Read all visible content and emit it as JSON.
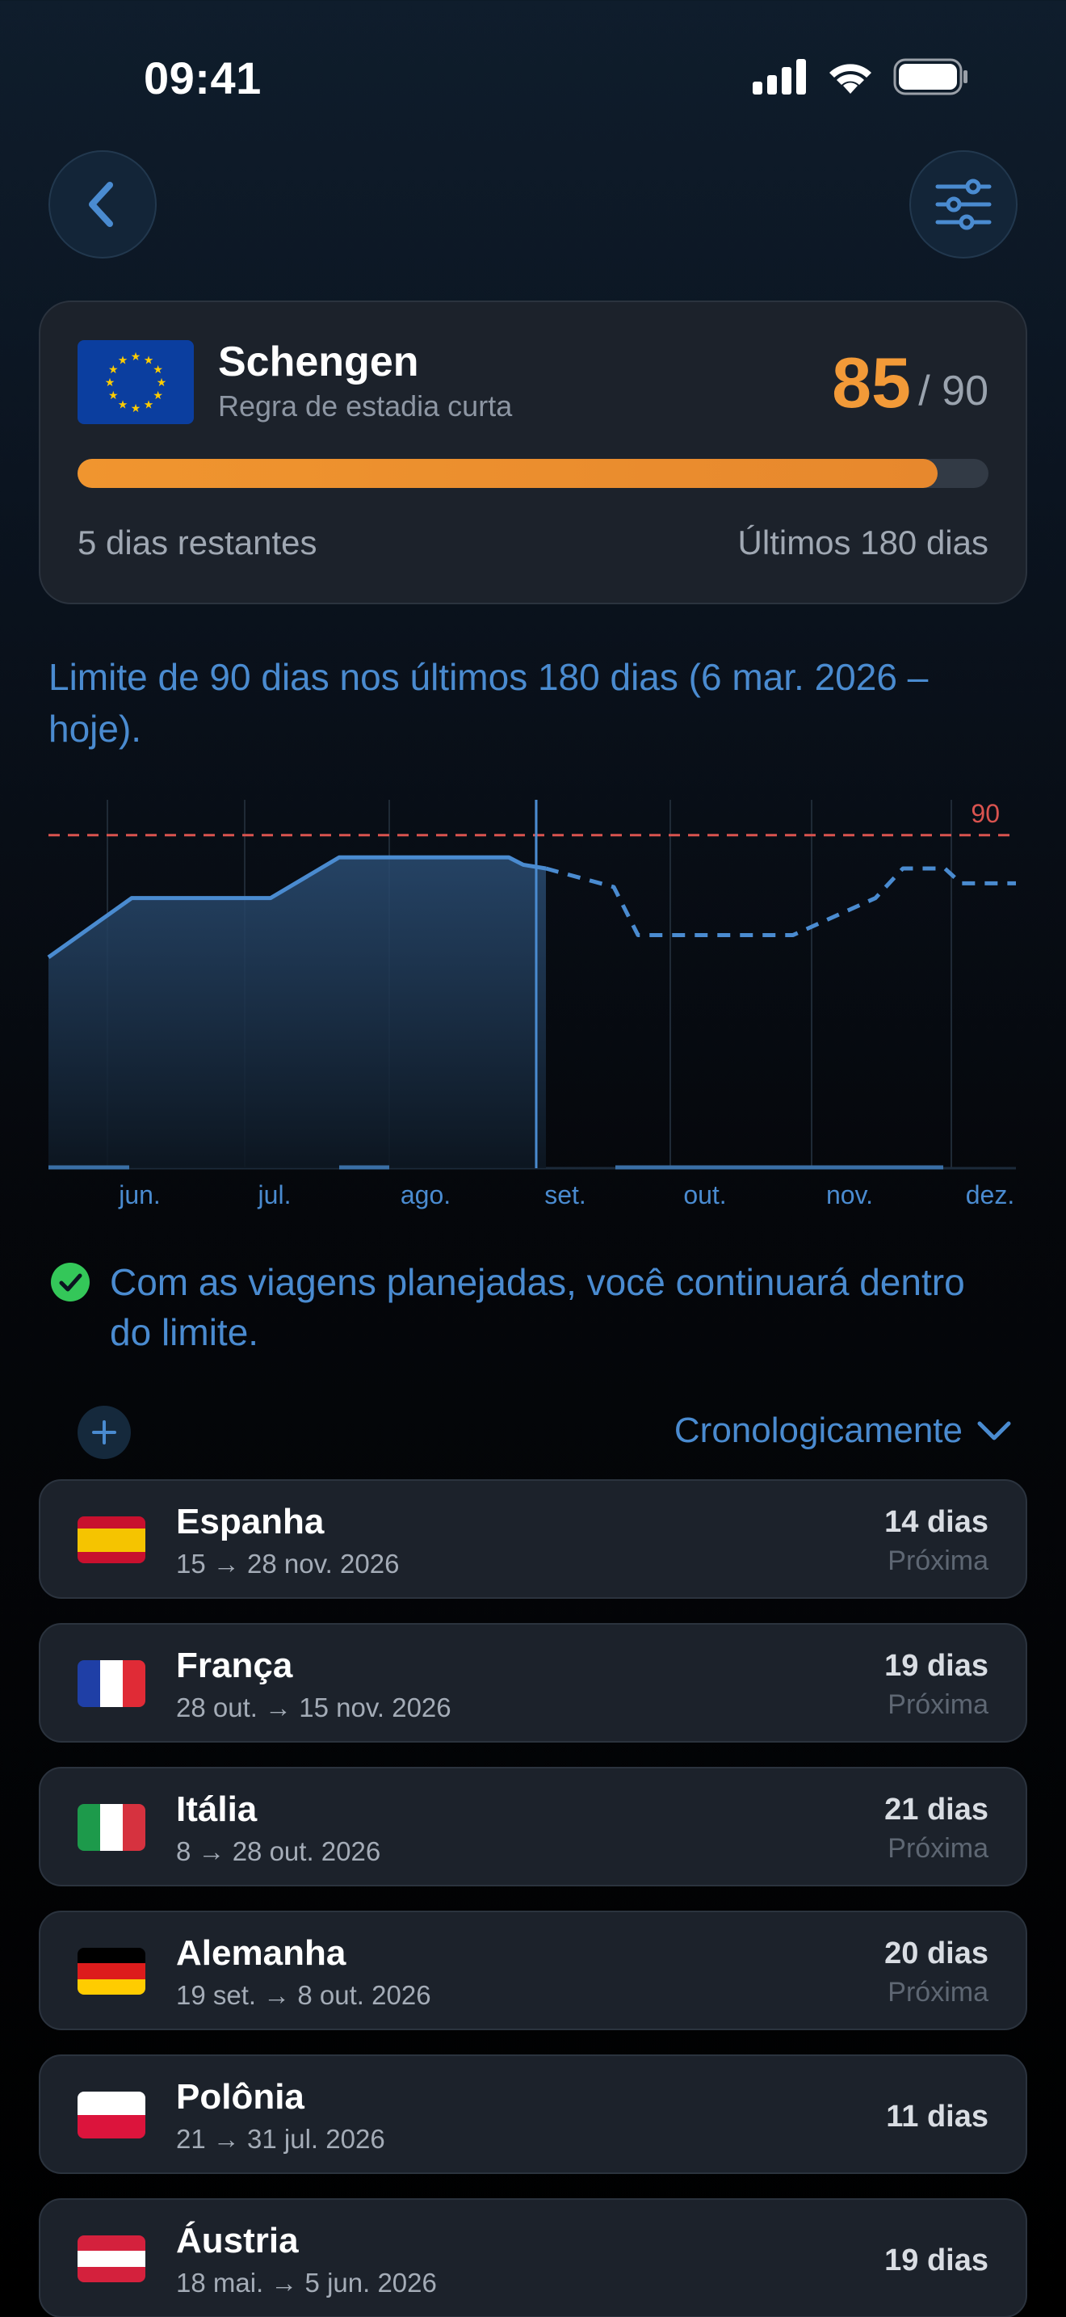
{
  "status_bar": {
    "time": "09:41"
  },
  "summary": {
    "region": "Schengen",
    "rule": "Regra de estadia curta",
    "used": "85",
    "limit": "/ 90",
    "progress_fraction": 0.944,
    "remaining": "5 dias restantes",
    "window": "Últimos 180 dias"
  },
  "explanation": "Limite de 90 dias nos últimos 180 dias (6 mar. 2026 – hoje).",
  "chart_data": {
    "type": "area",
    "limit": 90,
    "limit_label": "90",
    "x_labels": [
      "jun.",
      "jul.",
      "ago.",
      "set.",
      "out.",
      "nov.",
      "dez."
    ],
    "ylim": [
      0,
      100
    ],
    "series": [
      {
        "values": [
          57,
          73,
          73,
          73,
          84,
          84,
          84,
          82,
          81
        ]
      },
      {
        "values": [
          81,
          76,
          63,
          63,
          63,
          63,
          73,
          81,
          81,
          77,
          77
        ]
      }
    ]
  },
  "status_message": "Com as viagens planejadas, você continuará dentro do limite.",
  "toolbar": {
    "sort_label": "Cronologicamente"
  },
  "trips": [
    {
      "country": "Espanha",
      "dates": "15 → 28 nov. 2026",
      "days": "14 dias",
      "status": "Próxima",
      "flag": "es"
    },
    {
      "country": "França",
      "dates": "28 out. → 15 nov. 2026",
      "days": "19 dias",
      "status": "Próxima",
      "flag": "fr"
    },
    {
      "country": "Itália",
      "dates": "8 → 28 out. 2026",
      "days": "21 dias",
      "status": "Próxima",
      "flag": "it"
    },
    {
      "country": "Alemanha",
      "dates": "19 set. → 8 out. 2026",
      "days": "20 dias",
      "status": "Próxima",
      "flag": "de"
    },
    {
      "country": "Polônia",
      "dates": "21 → 31 jul. 2026",
      "days": "11 dias",
      "status": "",
      "flag": "pl"
    },
    {
      "country": "Áustria",
      "dates": "18 mai. → 5 jun. 2026",
      "days": "19 dias",
      "status": "",
      "flag": "at"
    }
  ],
  "colors": {
    "accent": "#4a8bd0",
    "progress": "#f0952f",
    "limit_line": "#d9534f",
    "success": "#34c759"
  }
}
